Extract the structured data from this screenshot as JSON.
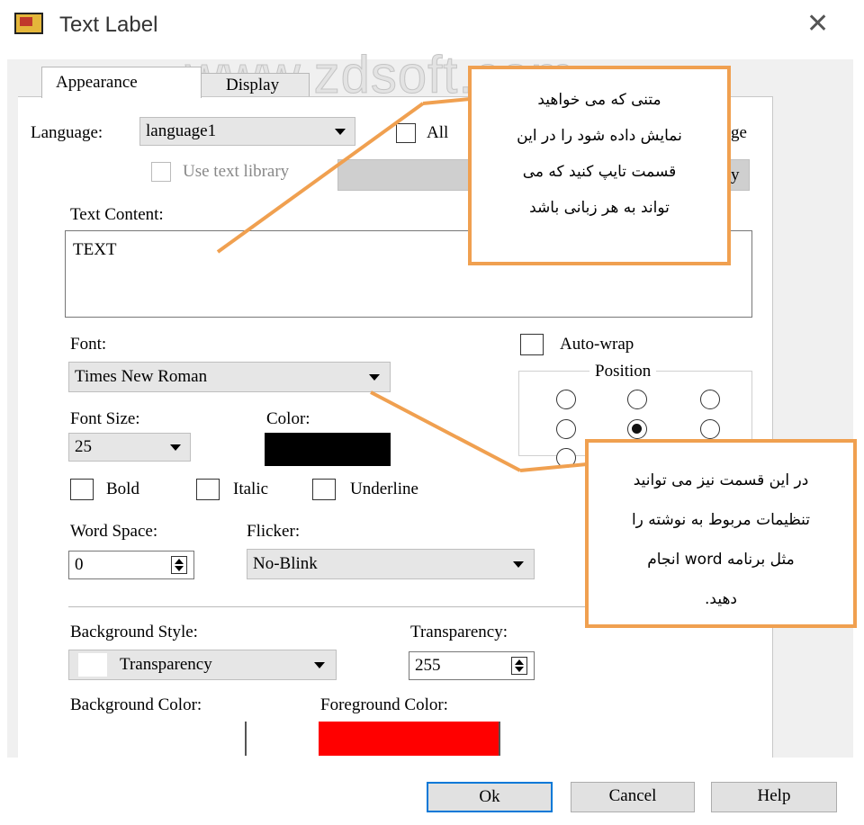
{
  "window": {
    "title": "Text Label"
  },
  "watermark": "www.zdsoft.com",
  "tabs": [
    "Appearance",
    "Display"
  ],
  "language": {
    "label": "Language:",
    "value": "language1",
    "all_label": "All",
    "all_suffix": "ge"
  },
  "text_library": {
    "label": "Use text library",
    "button_suffix": "y"
  },
  "text_content": {
    "label": "Text Content:",
    "value": "TEXT"
  },
  "font": {
    "label": "Font:",
    "value": "Times New Roman"
  },
  "auto_wrap": {
    "label": "Auto-wrap"
  },
  "position": {
    "label": "Position",
    "selected": "center"
  },
  "font_size": {
    "label": "Font Size:",
    "value": "25"
  },
  "color": {
    "label": "Color:",
    "value": "#000000"
  },
  "styles": {
    "bold": "Bold",
    "italic": "Italic",
    "underline": "Underline"
  },
  "word_space": {
    "label": "Word Space:",
    "value": "0"
  },
  "flicker": {
    "label": "Flicker:",
    "value": "No-Blink"
  },
  "background_style": {
    "label": "Background Style:",
    "value": "Transparency"
  },
  "transparency": {
    "label": "Transparency:",
    "value": "255"
  },
  "background_color": {
    "label": "Background Color:",
    "value": "#ffffff"
  },
  "foreground_color": {
    "label": "Foreground Color:",
    "value": "#ff0000"
  },
  "buttons": {
    "ok": "Ok",
    "cancel": "Cancel",
    "help": "Help"
  },
  "annotations": {
    "note1": [
      "متنی که می خواهید",
      "نمایش داده شود را در این",
      "قسمت تایپ کنید که می",
      "تواند به هر زبانی باشد"
    ],
    "note2": [
      "در این قسمت نیز می توانید",
      "تنظیمات مربوط به نوشته را",
      "مثل برنامه word انجام",
      "دهید."
    ],
    "accent": "#f0a050"
  }
}
